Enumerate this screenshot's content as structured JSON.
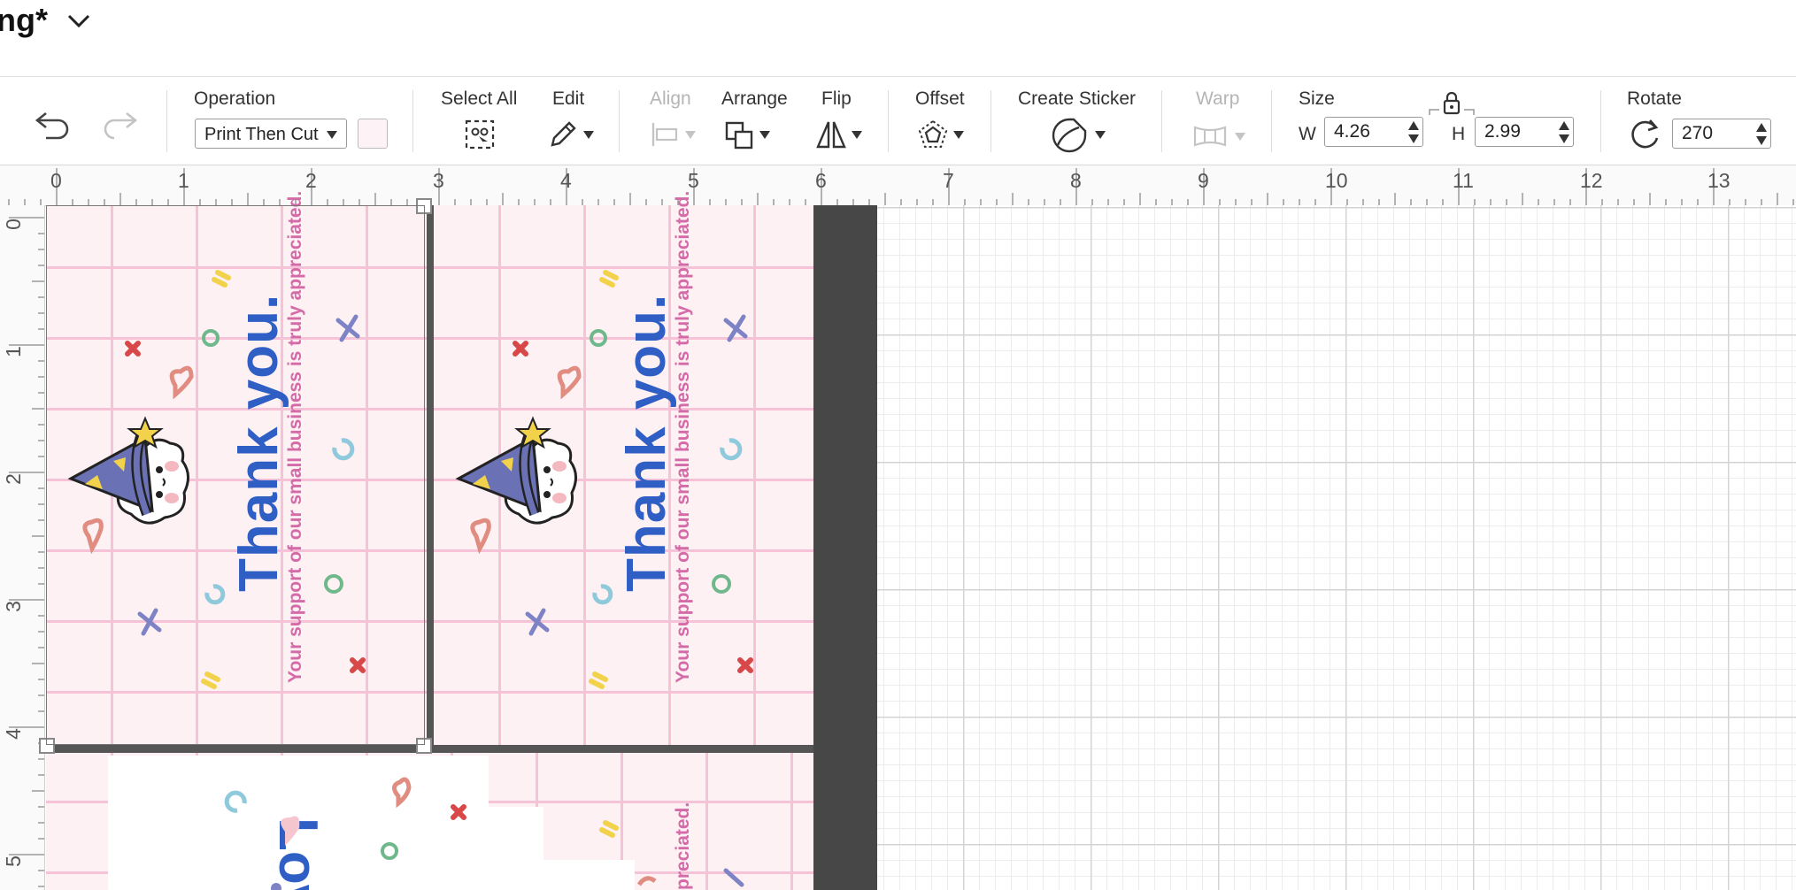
{
  "window": {
    "title": "ng*"
  },
  "toolbar": {
    "undo": "undo",
    "redo": "redo",
    "operation": {
      "label": "Operation",
      "value": "Print Then Cut"
    },
    "select_all": {
      "label": "Select All"
    },
    "edit": {
      "label": "Edit"
    },
    "align": {
      "label": "Align"
    },
    "arrange": {
      "label": "Arrange"
    },
    "flip": {
      "label": "Flip"
    },
    "offset": {
      "label": "Offset"
    },
    "create_sticker": {
      "label": "Create Sticker"
    },
    "warp": {
      "label": "Warp"
    },
    "size": {
      "label": "Size",
      "w_label": "W",
      "w_value": "4.26",
      "h_label": "H",
      "h_value": "2.99"
    },
    "rotate": {
      "label": "Rotate",
      "value": "270"
    }
  },
  "ruler": {
    "horizontal": [
      "0",
      "1",
      "2",
      "3",
      "4",
      "5",
      "6",
      "7",
      "8",
      "9",
      "10",
      "11",
      "12",
      "13"
    ],
    "vertical": [
      "0",
      "1",
      "2",
      "3",
      "4",
      "5"
    ]
  },
  "canvas": {
    "card_heading": "Thank you.",
    "card_message": "Your support of our small business is truly appreciated.",
    "partial_heading": "Lov",
    "partial_message": "preciated."
  },
  "colors": {
    "accent_blue": "#2f5fc4",
    "message_pink": "#d56aa8",
    "mat_dark": "#474747"
  }
}
